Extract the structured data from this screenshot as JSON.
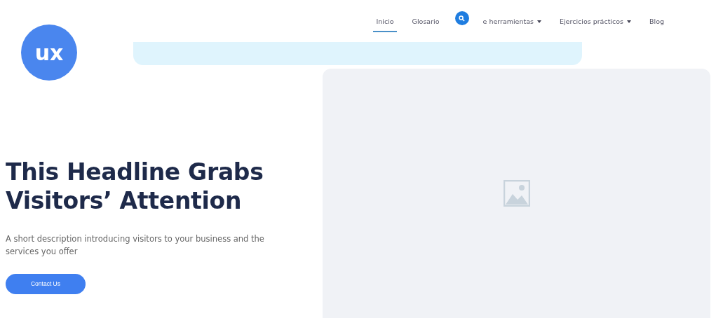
{
  "logo": {
    "text": "ux"
  },
  "nav": [
    {
      "label": "Inicio",
      "selected": true,
      "dropdown": false
    },
    {
      "label": "Glosario",
      "selected": false,
      "dropdown": false
    },
    {
      "label": "e herramientas",
      "selected": false,
      "dropdown": true,
      "search_overlay": true
    },
    {
      "label": "Ejercicios prácticos",
      "selected": false,
      "dropdown": true
    },
    {
      "label": "Blog",
      "selected": false,
      "dropdown": false
    }
  ],
  "hero": {
    "headline": "This Headline Grabs Visitors’ Attention",
    "description": "A short description introducing visitors to your business and the services you offer",
    "button": "Contact Us"
  },
  "image": {
    "kind": "placeholder"
  }
}
